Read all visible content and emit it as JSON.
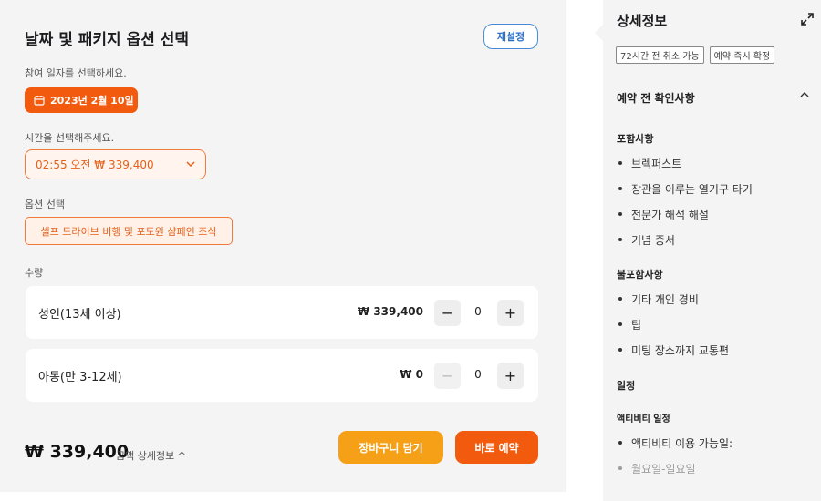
{
  "booking": {
    "title": "날짜 및 패키지 옵션 선택",
    "reset_label": "재설정",
    "date_prompt": "참여 일자를 선택하세요.",
    "date_value": "2023년 2월 10일",
    "time_prompt": "시간을 선택해주세요.",
    "time_value": "02:55 오전 ₩ 339,400",
    "option_prompt": "옵션 선택",
    "option_value": "셀프 드라이브 비행 및 포도원 샴페인 조식",
    "quantity_prompt": "수량",
    "quantity_rows": [
      {
        "label": "성인(13세 이상)",
        "price": "₩ 339,400",
        "count": "0",
        "minus": "−",
        "plus": "+"
      },
      {
        "label": "아동(만 3-12세)",
        "price": "₩ 0",
        "count": "0",
        "minus": "−",
        "plus": "+"
      }
    ],
    "total": "₩ 339,400",
    "price_detail_label": "금액 상세정보 ^",
    "cart_label": "장바구니 담기",
    "book_label": "바로 예약"
  },
  "details": {
    "title": "상세정보",
    "tags": [
      "72시간 전 취소 가능",
      "예약 즉시 확정"
    ],
    "pre_check_title": "예약 전 확인사항",
    "included_title": "포함사항",
    "included_items": [
      "브렉퍼스트",
      "장관을 이루는 열기구 타기",
      "전문가 해석 해설",
      "기념 증서"
    ],
    "excluded_title": "불포함사항",
    "excluded_items": [
      "기타 개인 경비",
      "팁",
      "미팅 장소까지 교통편"
    ],
    "schedule_title": "일정",
    "activity_title": "액티비티 일정",
    "activity_items": [
      "액티비티 이용 가능일:",
      "월요일-일요일"
    ]
  },
  "colors": {
    "accent": "#f25a0e",
    "cart": "#f5a016",
    "link": "#2a6fc7",
    "panel_bg": "#f4f4f5"
  },
  "icons": {
    "calendar": "calendar-icon",
    "chevron": "chevron-down-icon",
    "expand": "expand-icon",
    "collapse": "chevron-up-icon"
  }
}
